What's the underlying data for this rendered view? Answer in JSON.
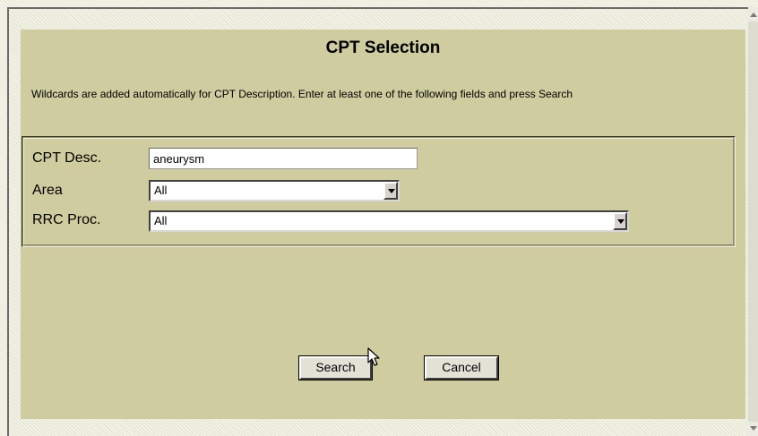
{
  "dialog": {
    "title": "CPT Selection",
    "instructions": "Wildcards are added automatically for CPT Description. Enter at least one of the following fields and press Search"
  },
  "form": {
    "cpt_desc": {
      "label": "CPT Desc.",
      "value": "aneurysm"
    },
    "area": {
      "label": "Area",
      "selected": "All"
    },
    "rrc_proc": {
      "label": "RRC Proc.",
      "selected": "All"
    }
  },
  "buttons": {
    "search": "Search",
    "cancel": "Cancel"
  },
  "icons": {
    "cursor": "pointer-cursor-icon",
    "dropdown": "chevron-down-icon",
    "scroll_up": "scroll-up-arrow-icon",
    "scroll_down": "scroll-down-arrow-icon"
  },
  "colors": {
    "panel": "#cfcc9f",
    "page_background": "#ececdc"
  }
}
